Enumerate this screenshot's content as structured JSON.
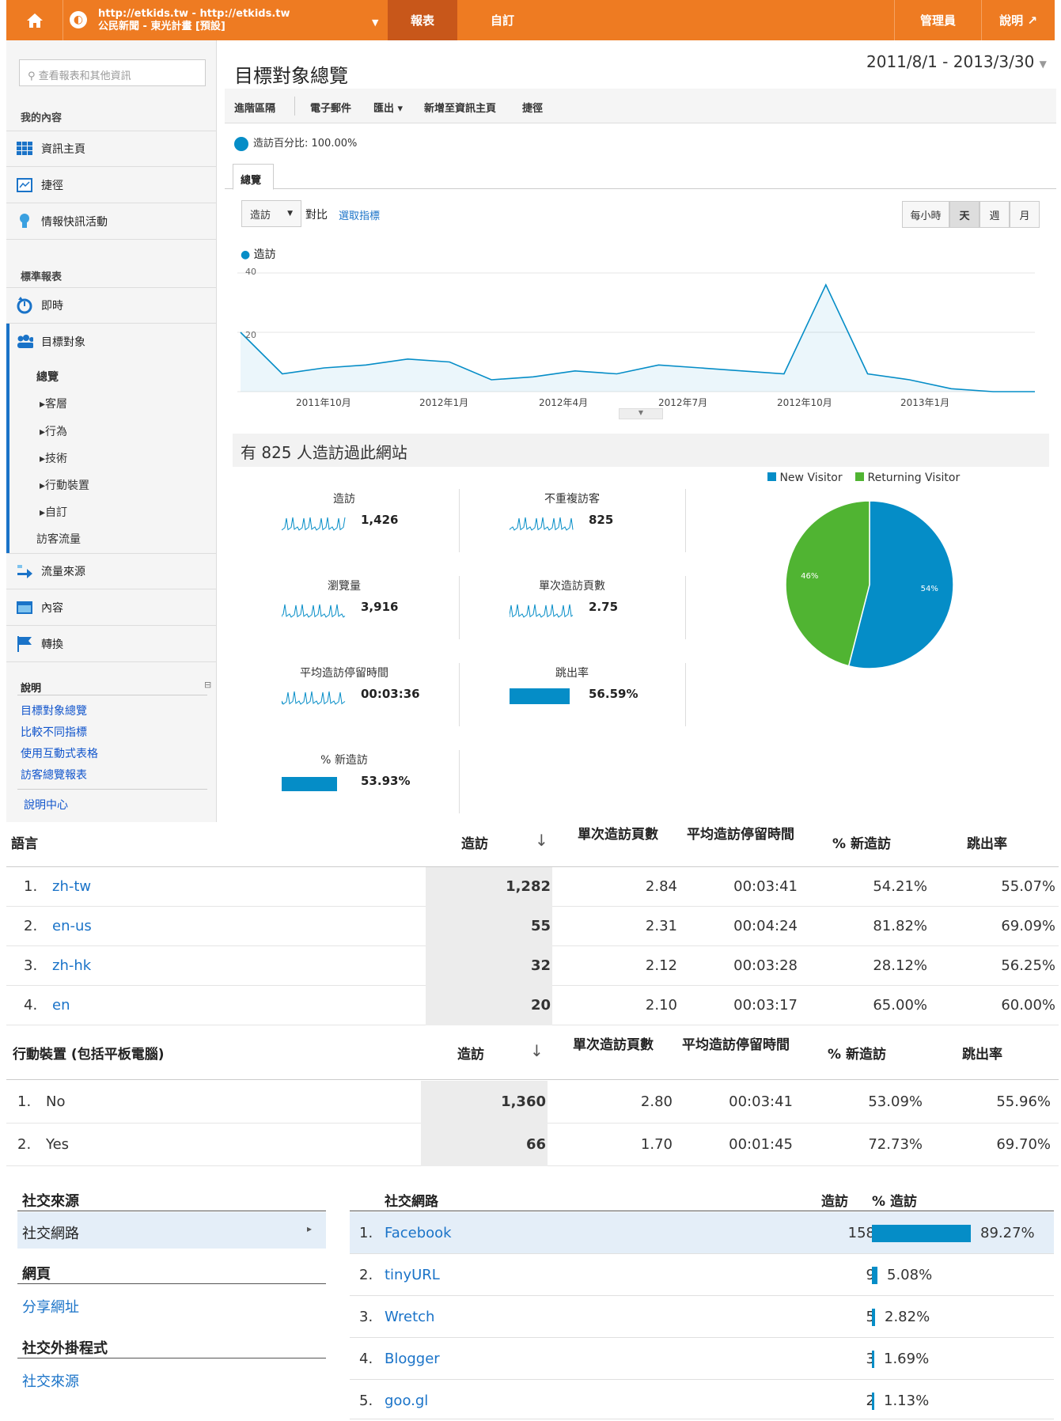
{
  "topbar": {
    "account_line1": "http://etkids.tw - http://etkids.tw",
    "account_line2": "公民新聞 - 東光計畫 [預設]",
    "tab_reports": "報表",
    "tab_custom": "自訂",
    "admin": "管理員",
    "help": "說明 ↗"
  },
  "sidebar": {
    "search_placeholder": "查看報表和其他資訊",
    "my_content": "我的內容",
    "nav1": [
      "資訊主頁",
      "捷徑",
      "情報快訊活動"
    ],
    "standard_reports": "標準報表",
    "nav2_realtime": "即時",
    "nav2_audience": "目標對象",
    "audience_sub": [
      "總覽",
      "客層",
      "行為",
      "技術",
      "行動裝置",
      "自訂",
      "訪客流量"
    ],
    "nav3": [
      "流量來源",
      "內容",
      "轉換"
    ],
    "help_title": "說明",
    "help_links": [
      "目標對象總覽",
      "比較不同指標",
      "使用互動式表格",
      "訪客總覽報表"
    ],
    "help_center": "說明中心"
  },
  "main": {
    "title": "目標對象總覽",
    "daterange": "2011/8/1 - 2013/3/30",
    "actions": [
      "進階區隔",
      "電子郵件",
      "匯出 ▾",
      "新增至資訊主頁",
      "捷徑"
    ],
    "segment": "造訪百分比: 100.00%",
    "tab": "總覽",
    "metric_select": "造訪",
    "vs": "對比",
    "select_metric": "選取指標",
    "granularity": [
      "每小時",
      "天",
      "週",
      "月"
    ],
    "series_label": "造訪",
    "summary": "有 825 人造訪過此網站"
  },
  "chart_data": {
    "type": "line",
    "series": [
      {
        "name": "造訪"
      }
    ],
    "y_ticks": [
      "40",
      "20"
    ],
    "ylim": [
      0,
      40
    ],
    "x_ticks": [
      "2011年10月",
      "2012年1月",
      "2012年4月",
      "2012年7月",
      "2012年10月",
      "2013年1月"
    ],
    "x": [
      "2011-08",
      "2011-09",
      "2011-10",
      "2011-11",
      "2011-12",
      "2012-01",
      "2012-02",
      "2012-03",
      "2012-04",
      "2012-05",
      "2012-06",
      "2012-07",
      "2012-08",
      "2012-09",
      "2012-10",
      "2012-11",
      "2012-12",
      "2013-01",
      "2013-02",
      "2013-03"
    ],
    "values": [
      20,
      6,
      8,
      9,
      11,
      10,
      4,
      5,
      7,
      6,
      9,
      8,
      7,
      6,
      36,
      6,
      4,
      1,
      0,
      0
    ]
  },
  "metrics": [
    {
      "label": "造訪",
      "value": "1,426"
    },
    {
      "label": "不重複訪客",
      "value": "825"
    },
    {
      "label": "瀏覽量",
      "value": "3,916"
    },
    {
      "label": "單次造訪頁數",
      "value": "2.75"
    },
    {
      "label": "平均造訪停留時間",
      "value": "00:03:36"
    },
    {
      "label": "跳出率",
      "value": "56.59%"
    },
    {
      "label": "% 新造訪",
      "value": "53.93%"
    }
  ],
  "pie": {
    "legend": [
      "New Visitor",
      "Returning Visitor"
    ],
    "slices": [
      {
        "name": "New Visitor",
        "value": 54,
        "label": "54%",
        "color": "#058dc7"
      },
      {
        "name": "Returning Visitor",
        "value": 46,
        "label": "46%",
        "color": "#50b432"
      }
    ]
  },
  "lang_table": {
    "headers": [
      "語言",
      "造訪",
      "單次造訪頁數",
      "平均造訪停留時間",
      "% 新造訪",
      "跳出率"
    ],
    "rows": [
      [
        "1.",
        "zh-tw",
        "1,282",
        "2.84",
        "00:03:41",
        "54.21%",
        "55.07%"
      ],
      [
        "2.",
        "en-us",
        "55",
        "2.31",
        "00:04:24",
        "81.82%",
        "69.09%"
      ],
      [
        "3.",
        "zh-hk",
        "32",
        "2.12",
        "00:03:28",
        "28.12%",
        "56.25%"
      ],
      [
        "4.",
        "en",
        "20",
        "2.10",
        "00:03:17",
        "65.00%",
        "60.00%"
      ]
    ]
  },
  "mobile_table": {
    "headers": [
      "行動裝置 (包括平板電腦)",
      "造訪",
      "單次造訪頁數",
      "平均造訪停留時間",
      "% 新造訪",
      "跳出率"
    ],
    "rows": [
      [
        "1.",
        "No",
        "1,360",
        "2.80",
        "00:03:41",
        "53.09%",
        "55.96%"
      ],
      [
        "2.",
        "Yes",
        "66",
        "1.70",
        "00:01:45",
        "72.73%",
        "69.70%"
      ]
    ]
  },
  "social": {
    "left_title1": "社交來源",
    "left_item1": "社交網路",
    "left_title2": "網頁",
    "left_item2": "分享網址",
    "left_title3": "社交外掛程式",
    "left_item3": "社交來源",
    "headers": [
      "社交網路",
      "造訪",
      "% 造訪"
    ],
    "rows": [
      {
        "n": "1.",
        "name": "Facebook",
        "visits": "158",
        "pct": "89.27%",
        "frac": 0.8927
      },
      {
        "n": "2.",
        "name": "tinyURL",
        "visits": "9",
        "pct": "5.08%",
        "frac": 0.0508
      },
      {
        "n": "3.",
        "name": "Wretch",
        "visits": "5",
        "pct": "2.82%",
        "frac": 0.0282
      },
      {
        "n": "4.",
        "name": "Blogger",
        "visits": "3",
        "pct": "1.69%",
        "frac": 0.0169
      },
      {
        "n": "5.",
        "name": "goo.gl",
        "visits": "2",
        "pct": "1.13%",
        "frac": 0.0113
      }
    ]
  },
  "colors": {
    "brand": "#ee7b22",
    "series": "#058dc7",
    "returning": "#50b432",
    "link": "#1a73c8"
  }
}
